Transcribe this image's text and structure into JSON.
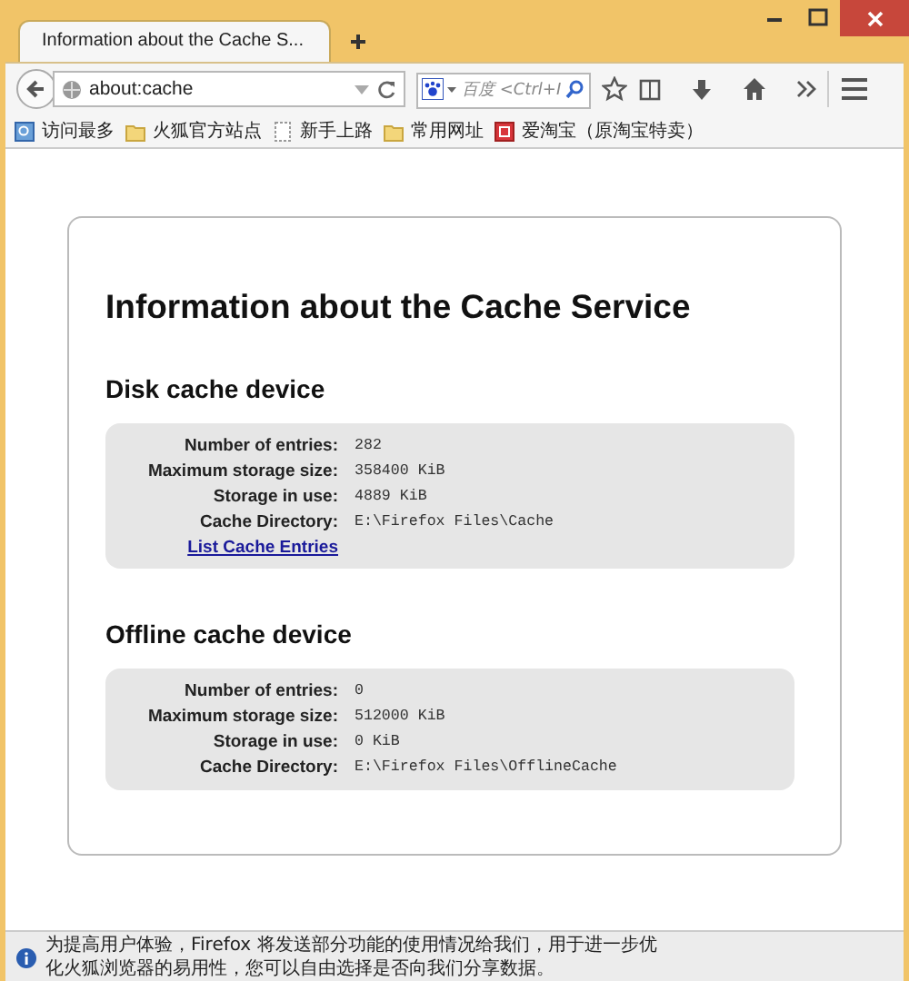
{
  "tabs": [
    {
      "label": "Information about the Cache S...",
      "selected": true
    }
  ],
  "address": {
    "value": "about:cache"
  },
  "search": {
    "placeholder": "百度 <Ctrl+I"
  },
  "bookmarks": [
    {
      "label": "访问最多",
      "kind": "smart"
    },
    {
      "label": "火狐官方站点",
      "kind": "folder"
    },
    {
      "label": "新手上路",
      "kind": "page"
    },
    {
      "label": "常用网址",
      "kind": "folder"
    },
    {
      "label": "爱淘宝（原淘宝特卖）",
      "kind": "site"
    }
  ],
  "page": {
    "title": "Information about the Cache Service",
    "sections": [
      {
        "heading": "Disk cache device",
        "rows": [
          {
            "label": "Number of entries:",
            "value": "282"
          },
          {
            "label": "Maximum storage size:",
            "value": "358400 KiB"
          },
          {
            "label": "Storage in use:",
            "value": "4889 KiB"
          },
          {
            "label": "Cache Directory:",
            "value": "E:\\Firefox Files\\Cache"
          }
        ],
        "link": "List Cache Entries"
      },
      {
        "heading": "Offline cache device",
        "rows": [
          {
            "label": "Number of entries:",
            "value": "0"
          },
          {
            "label": "Maximum storage size:",
            "value": "512000 KiB"
          },
          {
            "label": "Storage in use:",
            "value": "0 KiB"
          },
          {
            "label": "Cache Directory:",
            "value": "E:\\Firefox Files\\OfflineCache"
          }
        ]
      }
    ]
  },
  "notification": {
    "text": "为提高用户体验，Firefox 将发送部分功能的使用情况给我们，用于进一步优化火狐浏览器的易用性，您可以自由选择是否向我们分享数据。"
  }
}
